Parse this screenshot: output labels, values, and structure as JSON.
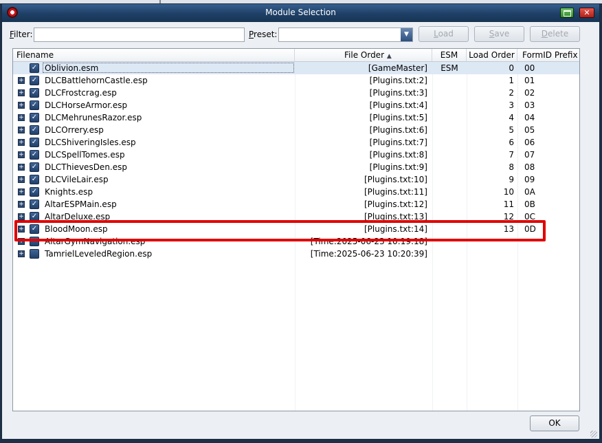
{
  "window": {
    "title": "Module Selection"
  },
  "filter": {
    "label_u": "F",
    "label_rest": "ilter:",
    "value": ""
  },
  "preset": {
    "label_u": "P",
    "label_rest": "reset:",
    "value": ""
  },
  "buttons": {
    "load": {
      "u": "L",
      "rest": "oad"
    },
    "save": {
      "u": "S",
      "rest": "ave"
    },
    "delete": {
      "u": "D",
      "rest": "elete"
    },
    "ok": "OK"
  },
  "columns": {
    "filename": "Filename",
    "file_order": "File Order",
    "sort_icon": "▲",
    "esm": "ESM",
    "load_order": "Load Order",
    "formid_prefix": "FormID Prefix"
  },
  "rows": [
    {
      "filename": "Oblivion.esm",
      "file_order": "[GameMaster]",
      "esm": "ESM",
      "load_order": "0",
      "formid": "00",
      "expander": "",
      "check": "✓"
    },
    {
      "filename": "DLCBattlehornCastle.esp",
      "file_order": "[Plugins.txt:2]",
      "esm": "",
      "load_order": "1",
      "formid": "01",
      "expander": "+",
      "check": "✓"
    },
    {
      "filename": "DLCFrostcrag.esp",
      "file_order": "[Plugins.txt:3]",
      "esm": "",
      "load_order": "2",
      "formid": "02",
      "expander": "+",
      "check": "✓"
    },
    {
      "filename": "DLCHorseArmor.esp",
      "file_order": "[Plugins.txt:4]",
      "esm": "",
      "load_order": "3",
      "formid": "03",
      "expander": "+",
      "check": "✓"
    },
    {
      "filename": "DLCMehrunesRazor.esp",
      "file_order": "[Plugins.txt:5]",
      "esm": "",
      "load_order": "4",
      "formid": "04",
      "expander": "+",
      "check": "✓"
    },
    {
      "filename": "DLCOrrery.esp",
      "file_order": "[Plugins.txt:6]",
      "esm": "",
      "load_order": "5",
      "formid": "05",
      "expander": "+",
      "check": "✓"
    },
    {
      "filename": "DLCShiveringIsles.esp",
      "file_order": "[Plugins.txt:7]",
      "esm": "",
      "load_order": "6",
      "formid": "06",
      "expander": "+",
      "check": "✓"
    },
    {
      "filename": "DLCSpellTomes.esp",
      "file_order": "[Plugins.txt:8]",
      "esm": "",
      "load_order": "7",
      "formid": "07",
      "expander": "+",
      "check": "✓"
    },
    {
      "filename": "DLCThievesDen.esp",
      "file_order": "[Plugins.txt:9]",
      "esm": "",
      "load_order": "8",
      "formid": "08",
      "expander": "+",
      "check": "✓"
    },
    {
      "filename": "DLCVileLair.esp",
      "file_order": "[Plugins.txt:10]",
      "esm": "",
      "load_order": "9",
      "formid": "09",
      "expander": "+",
      "check": "✓"
    },
    {
      "filename": "Knights.esp",
      "file_order": "[Plugins.txt:11]",
      "esm": "",
      "load_order": "10",
      "formid": "0A",
      "expander": "+",
      "check": "✓"
    },
    {
      "filename": "AltarESPMain.esp",
      "file_order": "[Plugins.txt:12]",
      "esm": "",
      "load_order": "11",
      "formid": "0B",
      "expander": "+",
      "check": "✓"
    },
    {
      "filename": "AltarDeluxe.esp",
      "file_order": "[Plugins.txt:13]",
      "esm": "",
      "load_order": "12",
      "formid": "0C",
      "expander": "+",
      "check": "✓"
    },
    {
      "filename": "BloodMoon.esp",
      "file_order": "[Plugins.txt:14]",
      "esm": "",
      "load_order": "13",
      "formid": "0D",
      "expander": "+",
      "check": "✓"
    },
    {
      "filename": "AltarGymNavigation.esp",
      "file_order": "[Time:2025-06-23 10:19:18]",
      "esm": "",
      "load_order": "",
      "formid": "",
      "expander": "+",
      "check": ""
    },
    {
      "filename": "TamrielLeveledRegion.esp",
      "file_order": "[Time:2025-06-23 10:20:39]",
      "esm": "",
      "load_order": "",
      "formid": "",
      "expander": "+",
      "check": ""
    }
  ],
  "colors": {
    "highlight": "#e00000",
    "titlebar": "#1e3f66",
    "selected_row": "#dde8f5"
  }
}
